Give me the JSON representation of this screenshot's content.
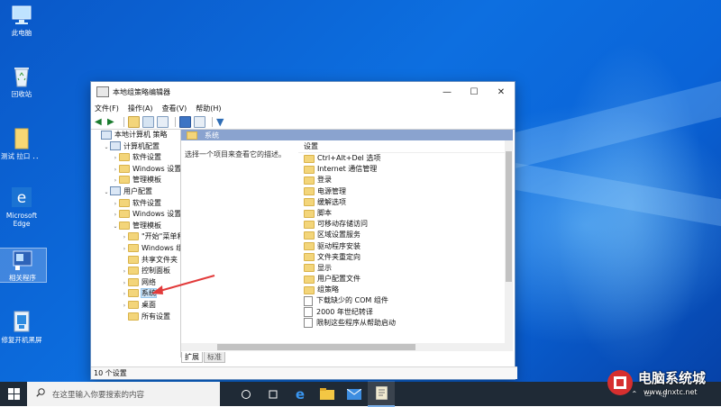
{
  "desktop_icons": [
    {
      "name": "pc",
      "label": "此电脑",
      "icon": "computer-icon"
    },
    {
      "name": "recycle",
      "label": "回收站",
      "icon": "recycle-bin-icon"
    },
    {
      "name": "test",
      "label": "测试 拉口 ．．",
      "icon": "folder-icon"
    },
    {
      "name": "edge",
      "label": "Microsoft Edge",
      "icon": "edge-icon"
    },
    {
      "name": "related",
      "label": "相关程序",
      "icon": "program-icon"
    },
    {
      "name": "repair",
      "label": "修复开机黑屏",
      "icon": "repair-tool-icon"
    }
  ],
  "window": {
    "title": "本地组策略编辑器",
    "controls": {
      "minimize": "—",
      "maximize": "☐",
      "close": "✕"
    },
    "menu": [
      "文件(F)",
      "操作(A)",
      "查看(V)",
      "帮助(H)"
    ],
    "tree": [
      {
        "label": "本地计算机 策略",
        "level": 0,
        "expander": "",
        "icon": "computer-policy-icon"
      },
      {
        "label": "计算机配置",
        "level": 1,
        "expander": "⌄",
        "icon": "computer-icon"
      },
      {
        "label": "软件设置",
        "level": 2,
        "expander": "›",
        "icon": "folder-icon"
      },
      {
        "label": "Windows 设置",
        "level": 2,
        "expander": "›",
        "icon": "folder-icon"
      },
      {
        "label": "管理模板",
        "level": 2,
        "expander": "›",
        "icon": "folder-icon"
      },
      {
        "label": "用户配置",
        "level": 1,
        "expander": "⌄",
        "icon": "user-icon"
      },
      {
        "label": "软件设置",
        "level": 2,
        "expander": "›",
        "icon": "folder-icon"
      },
      {
        "label": "Windows 设置",
        "level": 2,
        "expander": "›",
        "icon": "folder-icon"
      },
      {
        "label": "管理模板",
        "level": 2,
        "expander": "⌄",
        "icon": "folder-icon"
      },
      {
        "label": "\"开始\"菜单和",
        "level": 3,
        "expander": "›",
        "icon": "folder-icon"
      },
      {
        "label": "Windows 组",
        "level": 3,
        "expander": "›",
        "icon": "folder-icon"
      },
      {
        "label": "共享文件夹",
        "level": 3,
        "expander": "",
        "icon": "folder-icon"
      },
      {
        "label": "控制面板",
        "level": 3,
        "expander": "›",
        "icon": "folder-icon"
      },
      {
        "label": "网络",
        "level": 3,
        "expander": "›",
        "icon": "folder-icon"
      },
      {
        "label": "系统",
        "level": 3,
        "expander": "›",
        "icon": "folder-icon",
        "selected": true
      },
      {
        "label": "桌面",
        "level": 3,
        "expander": "›",
        "icon": "folder-icon"
      },
      {
        "label": "所有设置",
        "level": 3,
        "expander": "",
        "icon": "folder-icon"
      }
    ],
    "right_header": "系统",
    "description": "选择一个项目来查看它的描述。",
    "column_header": "设置",
    "items": [
      {
        "label": "Ctrl+Alt+Del 选项",
        "type": "folder"
      },
      {
        "label": "Internet 通信管理",
        "type": "folder"
      },
      {
        "label": "登录",
        "type": "folder"
      },
      {
        "label": "电源管理",
        "type": "folder"
      },
      {
        "label": "缓解选项",
        "type": "folder"
      },
      {
        "label": "脚本",
        "type": "folder"
      },
      {
        "label": "可移动存储访问",
        "type": "folder"
      },
      {
        "label": "区域设置服务",
        "type": "folder"
      },
      {
        "label": "驱动程序安装",
        "type": "folder"
      },
      {
        "label": "文件夹重定向",
        "type": "folder"
      },
      {
        "label": "显示",
        "type": "folder"
      },
      {
        "label": "用户配置文件",
        "type": "folder"
      },
      {
        "label": "组策略",
        "type": "folder"
      },
      {
        "label": "下载缺少的 COM 组件",
        "type": "policy"
      },
      {
        "label": "2000 年世纪转译",
        "type": "policy"
      },
      {
        "label": "限制这些程序从帮助启动",
        "type": "policy"
      }
    ],
    "tabs": [
      "扩展",
      "标准"
    ],
    "status": "10 个设置"
  },
  "taskbar": {
    "search_placeholder": "在这里输入你要搜索的内容",
    "apps": [
      "task-view-icon",
      "edge-icon",
      "file-explorer-icon",
      "mail-icon",
      "group-policy-icon"
    ]
  },
  "watermark": {
    "title": "电脑系统城",
    "url": "www.dnxtc.net"
  },
  "colors": {
    "accent": "#0a64d8",
    "selection": "#cde4f7",
    "header_bar": "#8aa3cf",
    "arrow": "#e23b3b"
  }
}
